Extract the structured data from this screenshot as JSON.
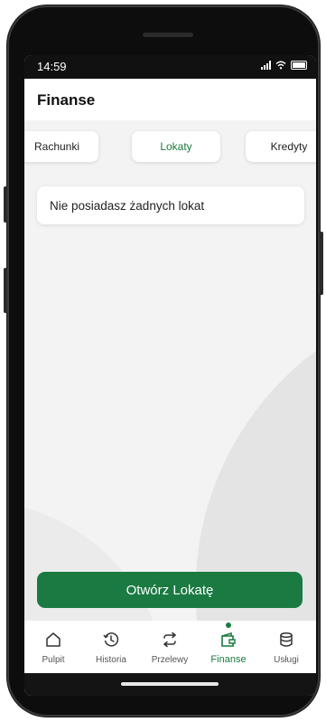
{
  "status_bar": {
    "time": "14:59"
  },
  "header": {
    "title": "Finanse"
  },
  "tabs": [
    {
      "label": "Rachunki"
    },
    {
      "label": "Lokaty"
    },
    {
      "label": "Kredyty"
    }
  ],
  "empty_state": {
    "message": "Nie posiadasz żadnych lokat"
  },
  "cta": {
    "label": "Otwórz Lokatę"
  },
  "bottom_nav": [
    {
      "label": "Pulpit",
      "icon": "home-icon"
    },
    {
      "label": "Historia",
      "icon": "history-icon"
    },
    {
      "label": "Przelewy",
      "icon": "transfer-icon"
    },
    {
      "label": "Finanse",
      "icon": "wallet-icon"
    },
    {
      "label": "Usługi",
      "icon": "database-icon"
    }
  ],
  "colors": {
    "accent": "#1b7a3e",
    "cta": "#1a7a42"
  }
}
